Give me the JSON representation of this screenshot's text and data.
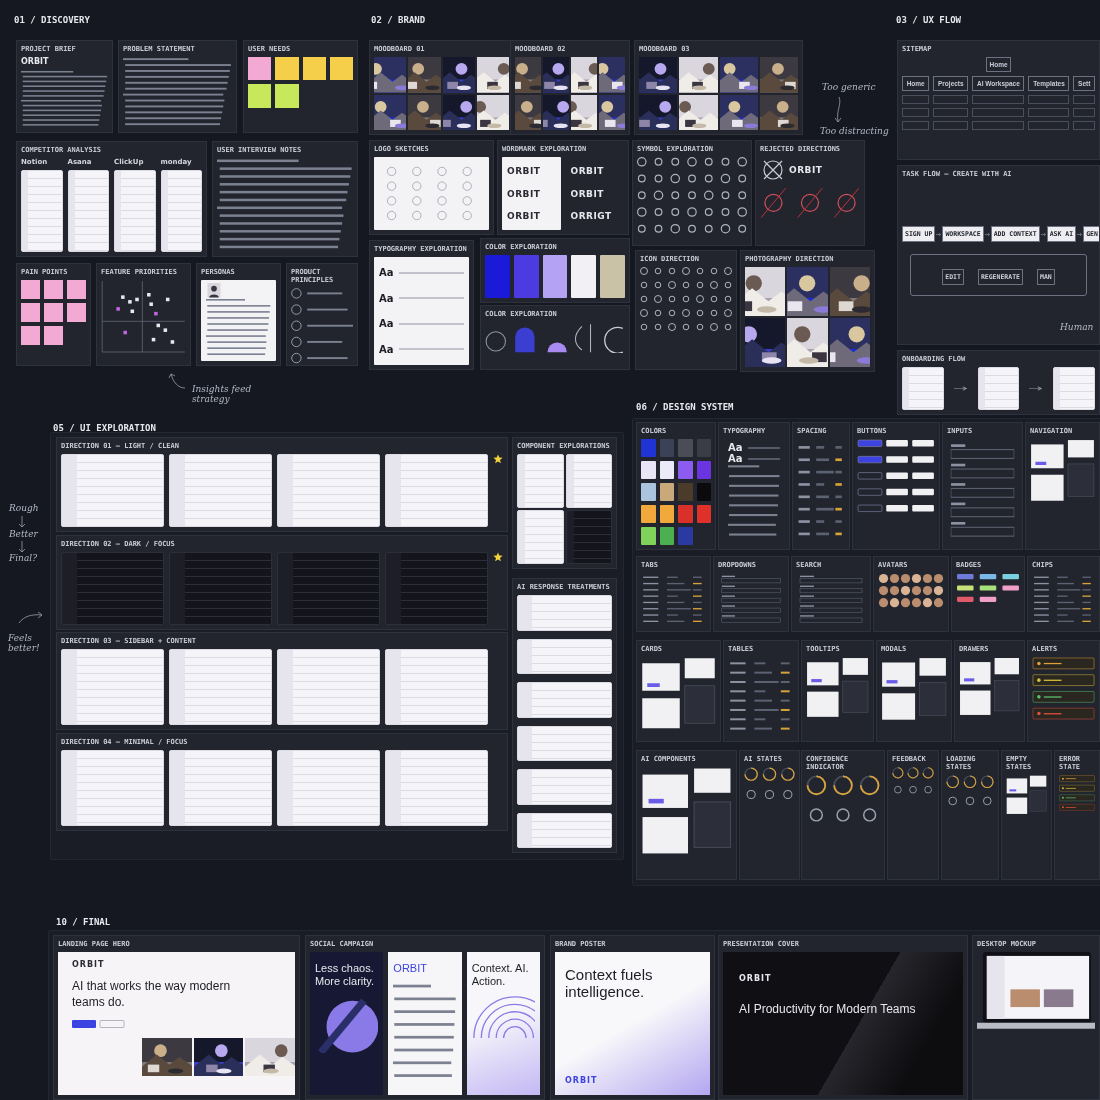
{
  "sections": [
    {
      "title": "01 / DISCOVERY",
      "cards": [
        {
          "title": "PROJECT BRIEF",
          "kind": "doc",
          "heading": "ORBIT"
        },
        {
          "title": "PROBLEM STATEMENT",
          "kind": "doc"
        },
        {
          "title": "USER NEEDS",
          "kind": "stickies",
          "notes": [
            {
              "color": "#f2a9d4"
            },
            {
              "color": "#f5cf4a"
            },
            {
              "color": "#f5cf4a"
            },
            {
              "color": "#f5cf4a"
            },
            {
              "color": "#c6e85a"
            },
            {
              "color": "#c6e85a"
            }
          ]
        },
        {
          "title": "COMPETITOR ANALYSIS",
          "kind": "competitors",
          "brands": [
            "Notion",
            "Asana",
            "ClickUp",
            "monday"
          ]
        },
        {
          "title": "USER INTERVIEW NOTES",
          "kind": "doc"
        },
        {
          "title": "PAIN POINTS",
          "kind": "stickies",
          "notes": [
            {
              "color": "#f2a9d4"
            },
            {
              "color": "#f2a9d4"
            },
            {
              "color": "#f2a9d4"
            },
            {
              "color": "#f2a9d4"
            },
            {
              "color": "#f2a9d4"
            },
            {
              "color": "#f2a9d4"
            },
            {
              "color": "#f2a9d4"
            },
            {
              "color": "#f2a9d4"
            }
          ]
        },
        {
          "title": "FEATURE PRIORITIES",
          "kind": "scatter"
        },
        {
          "title": "PERSONAS",
          "kind": "persona"
        },
        {
          "title": "PRODUCT PRINCIPLES",
          "kind": "principles"
        }
      ]
    },
    {
      "title": "02 / BRAND",
      "cards": [
        {
          "title": "MOODBOARD 01",
          "kind": "photos"
        },
        {
          "title": "MOODBOARD 02",
          "kind": "photos"
        },
        {
          "title": "MOODBOARD 03",
          "kind": "photos"
        },
        {
          "title": "LOGO SKETCHES",
          "kind": "sketches"
        },
        {
          "title": "WORDMARK EXPLORATION",
          "kind": "wordmarks",
          "marks": [
            {
              "text": "ORBIT",
              "dark": false
            },
            {
              "text": "ORBIT",
              "dark": true
            },
            {
              "text": "ORBIT",
              "dark": false
            },
            {
              "text": "ORBIT",
              "dark": true
            },
            {
              "text": "ORBIT",
              "dark": false
            },
            {
              "text": "ORRIGT",
              "dark": true
            }
          ]
        },
        {
          "title": "SYMBOL EXPLORATION",
          "kind": "icons"
        },
        {
          "title": "REJECTED DIRECTIONS",
          "kind": "rejected",
          "wordmark": "ORBIT"
        },
        {
          "title": "TYPOGRAPHY EXPLORATION",
          "kind": "type",
          "dark": false,
          "samples": [
            "Aa",
            "Aa",
            "Aa",
            "Aa"
          ]
        },
        {
          "title": "COLOR EXPLORATION",
          "kind": "swatches",
          "colors": [
            {
              "color": "#1a1ad8"
            },
            {
              "color": "#4b3be0"
            },
            {
              "color": "#b4a3f5"
            },
            {
              "color": "#f2eff5"
            },
            {
              "color": "#c9c2a6"
            }
          ]
        },
        {
          "title": "COLOR EXPLORATION",
          "kind": "shapes"
        },
        {
          "title": "ICON DIRECTION",
          "kind": "icons"
        },
        {
          "title": "PHOTOGRAPHY DIRECTION",
          "kind": "photos"
        }
      ]
    },
    {
      "title": "03 / UX FLOW",
      "cards": [
        {
          "title": "SITEMAP",
          "kind": "sitemap",
          "root": "Home",
          "branches": [
            "Home",
            "Projects",
            "AI Workspace",
            "Templates",
            "Sett"
          ]
        },
        {
          "title": "TASK FLOW – CREATE WITH AI",
          "kind": "flow",
          "steps": [
            "SIGN UP",
            "WORKSPACE",
            "ADD CONTEXT",
            "ASK AI",
            "GEN"
          ],
          "branches": [
            "EDIT",
            "REGENERATE",
            "MAN"
          ]
        },
        {
          "title": "ONBOARDING FLOW",
          "kind": "flowscreens",
          "screens": [
            {
              "dark": false
            },
            {
              "dark": false
            },
            {
              "dark": false
            }
          ]
        }
      ]
    },
    {
      "title": "05 / UI EXPLORATION",
      "cards": [
        {
          "title": "DIRECTION 01 – LIGHT / CLEAN",
          "kind": "screens",
          "starred": true,
          "screens": [
            {
              "dark": false
            },
            {
              "dark": false
            },
            {
              "dark": false
            },
            {
              "dark": false
            }
          ]
        },
        {
          "title": "DIRECTION 02 – DARK / FOCUS",
          "kind": "screens",
          "starred": true,
          "screens": [
            {
              "dark": true
            },
            {
              "dark": true
            },
            {
              "dark": true
            },
            {
              "dark": true
            }
          ]
        },
        {
          "title": "DIRECTION 03 – SIDEBAR + CONTENT",
          "kind": "screens",
          "starred": false,
          "screens": [
            {
              "dark": false
            },
            {
              "dark": false
            },
            {
              "dark": false
            },
            {
              "dark": false
            }
          ]
        },
        {
          "title": "DIRECTION 04 – MINIMAL / FOCUS",
          "kind": "screens",
          "starred": false,
          "screens": [
            {
              "dark": false
            },
            {
              "dark": false
            },
            {
              "dark": false
            },
            {
              "dark": false
            }
          ]
        },
        {
          "title": "COMPONENT EXPLORATIONS",
          "kind": "grid",
          "screens": [
            {
              "dark": false
            },
            {
              "dark": false
            },
            {
              "dark": false
            },
            {
              "dark": true
            }
          ]
        },
        {
          "title": "AI RESPONSE TREATMENTS",
          "kind": "stack",
          "screens": [
            {
              "dark": false
            },
            {
              "dark": false
            },
            {
              "dark": false
            },
            {
              "dark": false
            },
            {
              "dark": false
            },
            {
              "dark": false
            }
          ]
        }
      ]
    },
    {
      "title": "06 / DESIGN SYSTEM",
      "cards": [
        {
          "title": "COLORS",
          "kind": "swatches",
          "colors": [
            {
              "color": "#2034d6"
            },
            {
              "color": "#3b4258"
            },
            {
              "color": "#4a4d57"
            },
            {
              "color": "#3a3d45"
            },
            {
              "color": "#e8e6f6"
            },
            {
              "color": "#eceaf8"
            },
            {
              "color": "#8c5cf0"
            },
            {
              "color": "#6a35e0"
            },
            {
              "color": "#a9c4dc"
            },
            {
              "color": "#c9a97a"
            },
            {
              "color": "#4a3b2a"
            },
            {
              "color": "#0b0b0d"
            },
            {
              "color": "#f0a93a"
            },
            {
              "color": "#f0a93a"
            },
            {
              "color": "#d9302a"
            },
            {
              "color": "#e0302a"
            },
            {
              "color": "#7fd35a"
            },
            {
              "color": "#4caf50"
            },
            {
              "color": "#2a3aa0"
            }
          ]
        },
        {
          "title": "TYPOGRAPHY",
          "kind": "type",
          "dark": true,
          "samples": [
            "Aa",
            "Aa"
          ]
        },
        {
          "title": "SPACING",
          "kind": "lines"
        },
        {
          "title": "BUTTONS",
          "kind": "buttons"
        },
        {
          "title": "INPUTS",
          "kind": "fields"
        },
        {
          "title": "NAVIGATION",
          "kind": "panel"
        },
        {
          "title": "TABS",
          "kind": "lines"
        },
        {
          "title": "DROPDOWNS",
          "kind": "fields"
        },
        {
          "title": "SEARCH",
          "kind": "fields"
        },
        {
          "title": "AVATARS",
          "kind": "avatars"
        },
        {
          "title": "BADGES",
          "kind": "badges"
        },
        {
          "title": "CHIPS",
          "kind": "lines"
        },
        {
          "title": "CARDS",
          "kind": "panel"
        },
        {
          "title": "TABLES",
          "kind": "lines"
        },
        {
          "title": "TOOLTIPS",
          "kind": "panel"
        },
        {
          "title": "MODALS",
          "kind": "panel"
        },
        {
          "title": "DRAWERS",
          "kind": "panel"
        },
        {
          "title": "ALERTS",
          "kind": "alerts"
        },
        {
          "title": "AI COMPONENTS",
          "kind": "panel"
        },
        {
          "title": "AI STATES",
          "kind": "rings"
        },
        {
          "title": "CONFIDENCE INDICATOR",
          "kind": "rings"
        },
        {
          "title": "FEEDBACK",
          "kind": "rings"
        },
        {
          "title": "LOADING STATES",
          "kind": "rings"
        },
        {
          "title": "EMPTY STATES",
          "kind": "panel"
        },
        {
          "title": "ERROR STATE",
          "kind": "alerts"
        }
      ]
    },
    {
      "title": "10 / FINAL",
      "cards": [
        {
          "title": "LANDING PAGE HERO",
          "kind": "hero",
          "logo": "ORBIT",
          "headline": "AI that works the way modern teams do."
        },
        {
          "title": "SOCIAL CAMPAIGN",
          "kind": "social",
          "posts": [
            "Less chaos. More clarity.",
            "ORBIT",
            "Context. AI. Action."
          ]
        },
        {
          "title": "BRAND POSTER",
          "kind": "poster",
          "headline": "Context fuels intelligence.",
          "logo": "ORBIT"
        },
        {
          "title": "PRESENTATION COVER",
          "kind": "cover",
          "logo": "ORBIT",
          "headline": "AI Productivity for Modern Teams"
        },
        {
          "title": "DESKTOP MOCKUP",
          "kind": "laptop"
        }
      ]
    }
  ],
  "notes": [
    {
      "text": "Too generic"
    },
    {
      "text": "Too distracting"
    },
    {
      "text": "Insights feed strategy"
    },
    {
      "text": "Rough"
    },
    {
      "text": "Better"
    },
    {
      "text": "Final?"
    },
    {
      "text": "Feels better!"
    },
    {
      "text": "Human"
    }
  ]
}
